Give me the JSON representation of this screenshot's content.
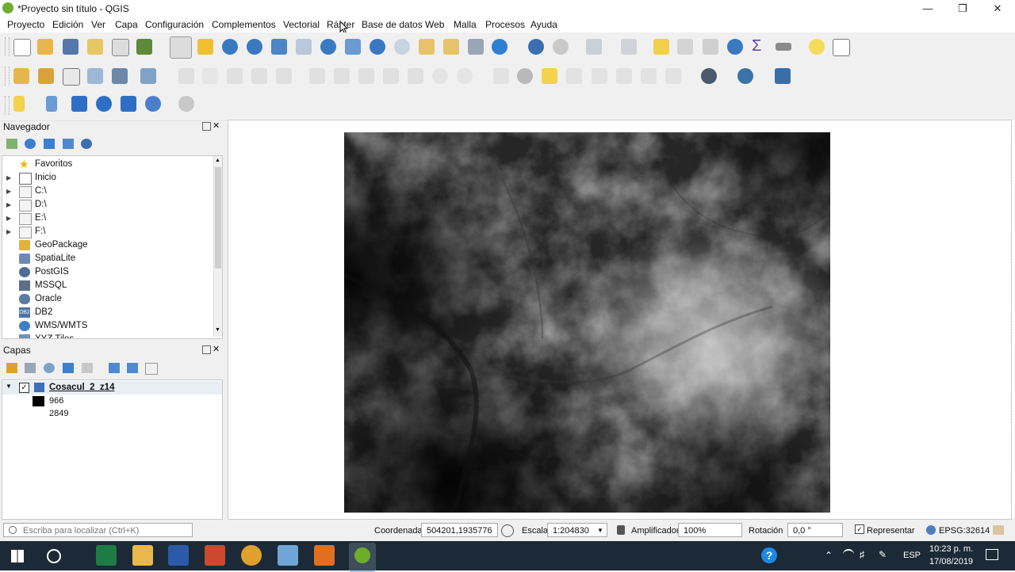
{
  "window": {
    "title": "*Proyecto sin título - QGIS"
  },
  "menu": [
    "Proyecto",
    "Edición",
    "Ver",
    "Capa",
    "Configuración",
    "Complementos",
    "Vectorial",
    "Ráster",
    "Base de datos",
    "Web",
    "Malla",
    "Procesos",
    "Ayuda"
  ],
  "browser": {
    "title": "Navegador",
    "items": [
      {
        "label": "Favoritos",
        "icon": "star-icon"
      },
      {
        "label": "Inicio",
        "icon": "home-icon"
      },
      {
        "label": "C:\\",
        "icon": "folder-icon"
      },
      {
        "label": "D:\\",
        "icon": "folder-icon"
      },
      {
        "label": "E:\\",
        "icon": "folder-icon"
      },
      {
        "label": "F:\\",
        "icon": "folder-icon"
      },
      {
        "label": "GeoPackage",
        "icon": "geopackage-icon"
      },
      {
        "label": "SpatiaLite",
        "icon": "spatialite-icon"
      },
      {
        "label": "PostGIS",
        "icon": "postgis-icon"
      },
      {
        "label": "MSSQL",
        "icon": "mssql-icon"
      },
      {
        "label": "Oracle",
        "icon": "oracle-icon"
      },
      {
        "label": "DB2",
        "icon": "db2-icon"
      },
      {
        "label": "WMS/WMTS",
        "icon": "globe-icon"
      },
      {
        "label": "XYZ Tiles",
        "icon": "tiles-icon"
      }
    ]
  },
  "layers_panel": {
    "title": "Capas",
    "layer_name": "Cosacul_2_z14",
    "legend_min": "966",
    "legend_max": "2849"
  },
  "status": {
    "search_placeholder": "Escriba para localizar (Ctrl+K)",
    "coord_label": "Coordenada",
    "coord_value": "504201,1935776",
    "scale_label": "Escala",
    "scale_value": "1:204830",
    "magnifier_label": "Amplificador",
    "magnifier_value": "100%",
    "rotation_label": "Rotación",
    "rotation_value": "0,0 °",
    "render_label": "Representar",
    "crs": "EPSG:32614"
  },
  "taskbar": {
    "time": "10:23 p. m.",
    "date": "17/08/2019",
    "lang": "ESP"
  },
  "colors": {
    "accent": "#6dad2b",
    "taskbar": "#1b2a36"
  }
}
